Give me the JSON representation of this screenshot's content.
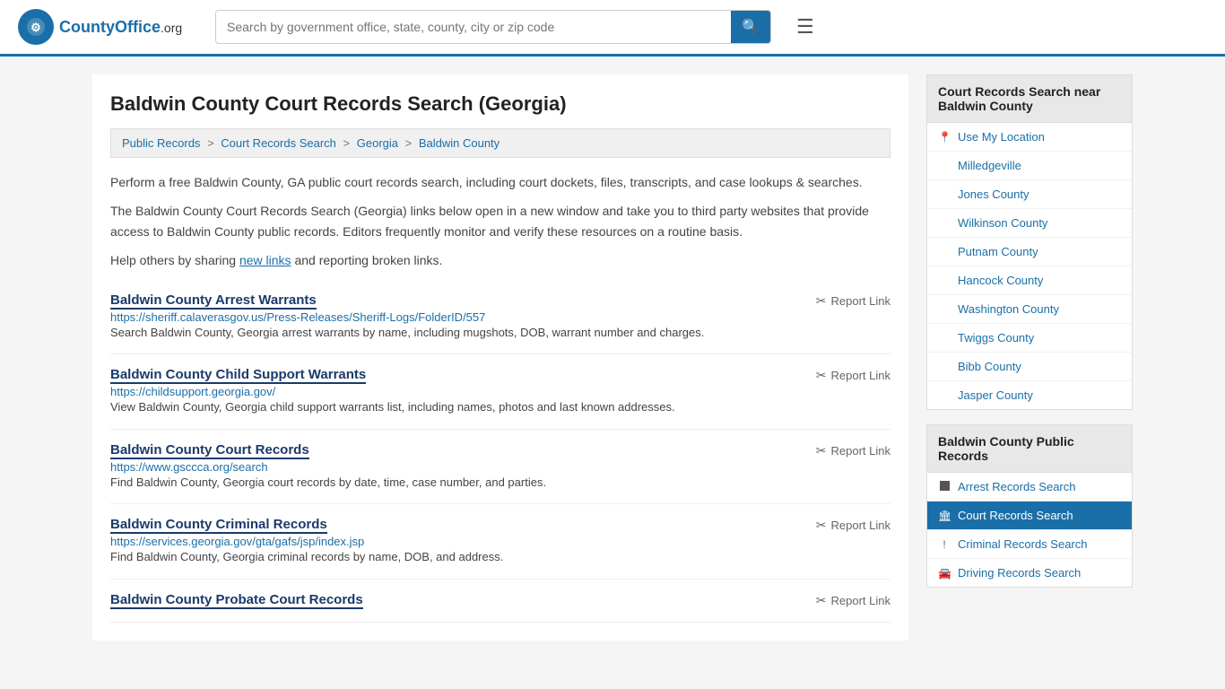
{
  "header": {
    "logo_text": "CountyOffice",
    "logo_tld": ".org",
    "search_placeholder": "Search by government office, state, county, city or zip code"
  },
  "page": {
    "title": "Baldwin County Court Records Search (Georgia)",
    "breadcrumb": [
      {
        "label": "Public Records",
        "href": "#"
      },
      {
        "label": "Court Records Search",
        "href": "#"
      },
      {
        "label": "Georgia",
        "href": "#"
      },
      {
        "label": "Baldwin County",
        "href": "#"
      }
    ],
    "description1": "Perform a free Baldwin County, GA public court records search, including court dockets, files, transcripts, and case lookups & searches.",
    "description2": "The Baldwin County Court Records Search (Georgia) links below open in a new window and take you to third party websites that provide access to Baldwin County public records. Editors frequently monitor and verify these resources on a routine basis.",
    "description3_pre": "Help others by sharing ",
    "description3_link": "new links",
    "description3_post": " and reporting broken links."
  },
  "records": [
    {
      "title": "Baldwin County Arrest Warrants",
      "url": "https://sheriff.calaverasgov.us/Press-Releases/Sheriff-Logs/FolderID/557",
      "desc": "Search Baldwin County, Georgia arrest warrants by name, including mugshots, DOB, warrant number and charges.",
      "report_label": "Report Link"
    },
    {
      "title": "Baldwin County Child Support Warrants",
      "url": "https://childsupport.georgia.gov/",
      "desc": "View Baldwin County, Georgia child support warrants list, including names, photos and last known addresses.",
      "report_label": "Report Link"
    },
    {
      "title": "Baldwin County Court Records",
      "url": "https://www.gsccca.org/search",
      "desc": "Find Baldwin County, Georgia court records by date, time, case number, and parties.",
      "report_label": "Report Link"
    },
    {
      "title": "Baldwin County Criminal Records",
      "url": "https://services.georgia.gov/gta/gafs/jsp/index.jsp",
      "desc": "Find Baldwin County, Georgia criminal records by name, DOB, and address.",
      "report_label": "Report Link"
    },
    {
      "title": "Baldwin County Probate Court Records",
      "url": "",
      "desc": "",
      "report_label": "Report Link"
    }
  ],
  "sidebar": {
    "nearby_title": "Court Records Search near Baldwin County",
    "nearby_links": [
      {
        "label": "Use My Location",
        "icon": "pin"
      },
      {
        "label": "Milledgeville",
        "icon": "none"
      },
      {
        "label": "Jones County",
        "icon": "none"
      },
      {
        "label": "Wilkinson County",
        "icon": "none"
      },
      {
        "label": "Putnam County",
        "icon": "none"
      },
      {
        "label": "Hancock County",
        "icon": "none"
      },
      {
        "label": "Washington County",
        "icon": "none"
      },
      {
        "label": "Twiggs County",
        "icon": "none"
      },
      {
        "label": "Bibb County",
        "icon": "none"
      },
      {
        "label": "Jasper County",
        "icon": "none"
      }
    ],
    "public_records_title": "Baldwin County Public Records",
    "public_records_links": [
      {
        "label": "Arrest Records Search",
        "icon": "square",
        "active": false
      },
      {
        "label": "Court Records Search",
        "icon": "bank",
        "active": true
      },
      {
        "label": "Criminal Records Search",
        "icon": "exclamation",
        "active": false
      },
      {
        "label": "Driving Records Search",
        "icon": "car",
        "active": false
      }
    ]
  }
}
